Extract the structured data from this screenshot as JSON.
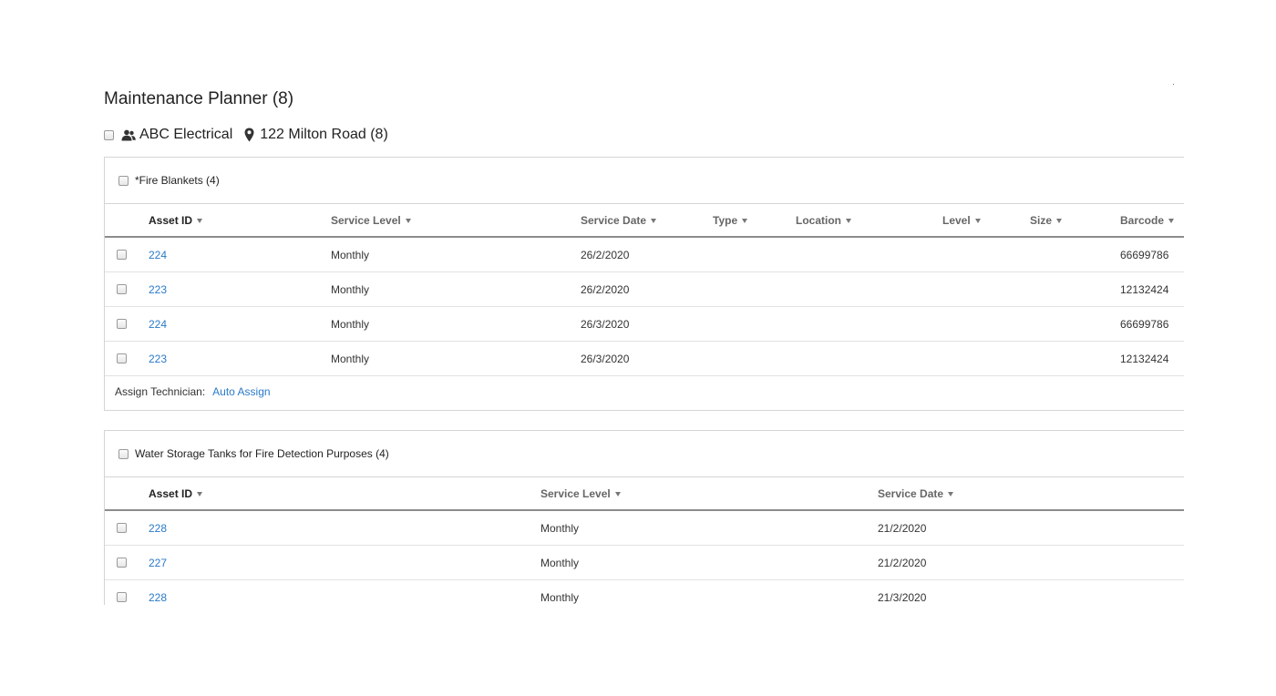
{
  "page": {
    "title": "Maintenance Planner (8)"
  },
  "client": {
    "name": "ABC Electrical",
    "site": "122 Milton Road (8)",
    "client_icon": "users-icon",
    "site_icon": "map-marker-icon"
  },
  "colors": {
    "link": "#2a7ac8",
    "border": "#d5d5d5",
    "header_rule": "#8c8c8c"
  },
  "groups": [
    {
      "title": "*Fire Blankets (4)",
      "columns": [
        "Asset ID",
        "Service Level",
        "Service Date",
        "Type",
        "Location",
        "Level",
        "Size",
        "Barcode"
      ],
      "rows": [
        {
          "asset_id": "224",
          "service_level": "Monthly",
          "service_date": "26/2/2020",
          "type": "",
          "location": "",
          "level": "",
          "size": "",
          "barcode": "66699786"
        },
        {
          "asset_id": "223",
          "service_level": "Monthly",
          "service_date": "26/2/2020",
          "type": "",
          "location": "",
          "level": "",
          "size": "",
          "barcode": "12132424"
        },
        {
          "asset_id": "224",
          "service_level": "Monthly",
          "service_date": "26/3/2020",
          "type": "",
          "location": "",
          "level": "",
          "size": "",
          "barcode": "66699786"
        },
        {
          "asset_id": "223",
          "service_level": "Monthly",
          "service_date": "26/3/2020",
          "type": "",
          "location": "",
          "level": "",
          "size": "",
          "barcode": "12132424"
        }
      ],
      "assign_label": "Assign Technician:",
      "assign_action": "Auto Assign"
    },
    {
      "title": "Water Storage Tanks for Fire Detection Purposes (4)",
      "columns": [
        "Asset ID",
        "Service Level",
        "Service Date"
      ],
      "rows": [
        {
          "asset_id": "228",
          "service_level": "Monthly",
          "service_date": "21/2/2020"
        },
        {
          "asset_id": "227",
          "service_level": "Monthly",
          "service_date": "21/2/2020"
        },
        {
          "asset_id": "228",
          "service_level": "Monthly",
          "service_date": "21/3/2020"
        }
      ]
    }
  ]
}
